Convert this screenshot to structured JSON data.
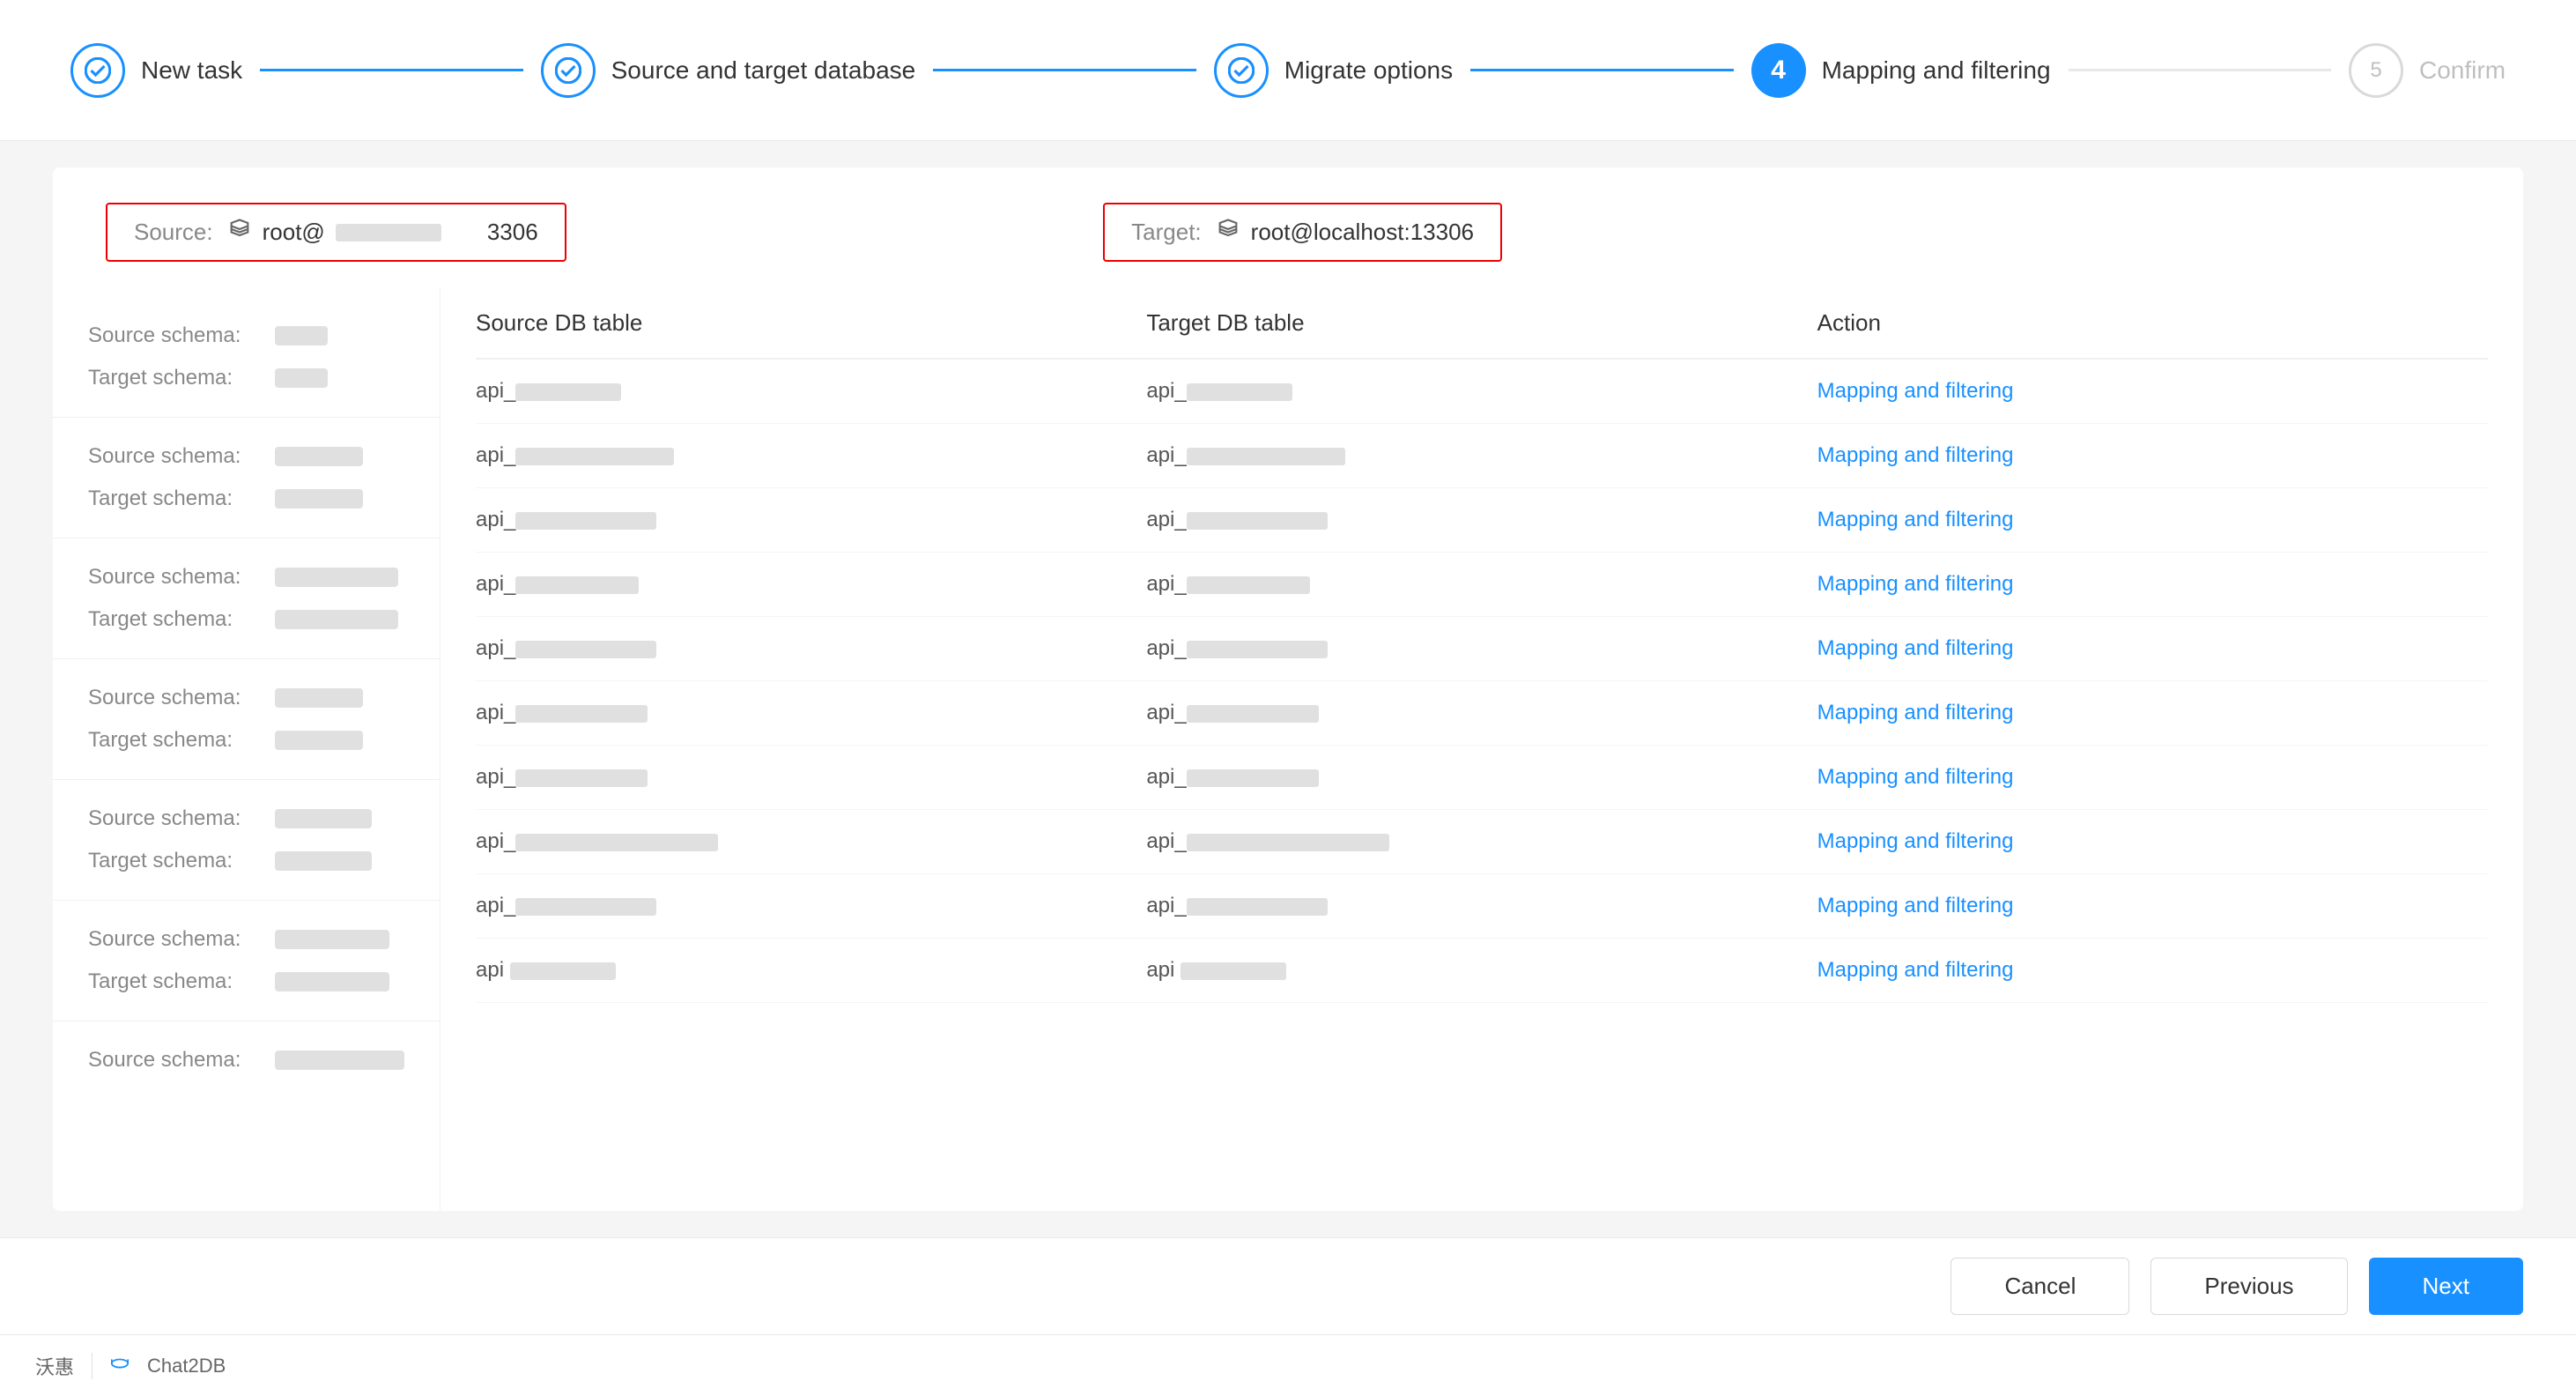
{
  "stepper": {
    "steps": [
      {
        "id": "new-task",
        "label": "New task",
        "state": "completed",
        "icon": "✓"
      },
      {
        "id": "source-target",
        "label": "Source and target database",
        "state": "completed",
        "icon": "✓"
      },
      {
        "id": "migrate-options",
        "label": "Migrate options",
        "state": "completed",
        "icon": "✓"
      },
      {
        "id": "mapping-filtering",
        "label": "Mapping and filtering",
        "state": "active",
        "icon": "4"
      },
      {
        "id": "confirm",
        "label": "Confirm",
        "state": "inactive",
        "icon": "5"
      }
    ]
  },
  "source": {
    "label": "Source:",
    "icon": "🔌",
    "user": "root@",
    "port": "3306"
  },
  "target": {
    "label": "Target:",
    "icon": "🔌",
    "value": "root@localhost:13306"
  },
  "table": {
    "headers": [
      "Source DB table",
      "Target DB table",
      "Action"
    ],
    "action_label": "Mapping and filtering",
    "rows": [
      {
        "source_prefix": "api_",
        "source_blur_width": 120,
        "target_prefix": "api_",
        "target_blur_width": 120
      },
      {
        "source_prefix": "api_",
        "source_blur_width": 180,
        "target_prefix": "api_",
        "target_blur_width": 180
      },
      {
        "source_prefix": "api_",
        "source_blur_width": 160,
        "target_prefix": "api_",
        "target_blur_width": 160
      },
      {
        "source_prefix": "api_",
        "source_blur_width": 140,
        "target_prefix": "api_",
        "target_blur_width": 140
      },
      {
        "source_prefix": "api_",
        "source_blur_width": 160,
        "target_prefix": "api_",
        "target_blur_width": 160
      },
      {
        "source_prefix": "api_",
        "source_blur_width": 150,
        "target_prefix": "api_",
        "target_blur_width": 150
      },
      {
        "source_prefix": "api_",
        "source_blur_width": 150,
        "target_prefix": "api_",
        "target_blur_width": 150
      },
      {
        "source_prefix": "api_",
        "source_blur_width": 230,
        "target_prefix": "api_",
        "target_blur_width": 230
      },
      {
        "source_prefix": "api_",
        "source_blur_width": 160,
        "target_prefix": "api_",
        "target_blur_width": 160
      },
      {
        "source_prefix": "api ",
        "source_blur_width": 120,
        "target_prefix": "api ",
        "target_blur_width": 120
      }
    ]
  },
  "sidebar": {
    "groups": [
      {
        "source_blur": 60,
        "target_blur": 60
      },
      {
        "source_blur": 100,
        "target_blur": 100
      },
      {
        "source_blur": 140,
        "target_blur": 140
      },
      {
        "source_blur": 100,
        "target_blur": 100
      },
      {
        "source_blur": 110,
        "target_blur": 110
      },
      {
        "source_blur": 130,
        "source_only": true
      }
    ],
    "source_label": "Source schema:",
    "target_label": "Target schema:"
  },
  "footer": {
    "cancel_label": "Cancel",
    "previous_label": "Previous",
    "next_label": "Next"
  },
  "bottom_bar": {
    "brand": "沃惠",
    "app": "Chat2DB"
  }
}
